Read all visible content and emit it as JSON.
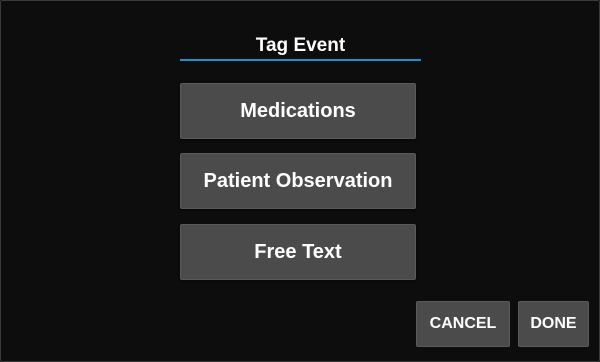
{
  "dialog": {
    "title": "Tag Event",
    "options": [
      {
        "label": "Medications"
      },
      {
        "label": "Patient Observation"
      },
      {
        "label": "Free Text"
      }
    ]
  },
  "actions": {
    "cancel_label": "CANCEL",
    "done_label": "DONE"
  },
  "colors": {
    "background": "#0d0d0d",
    "button": "#4b4b4b",
    "accent_underline": "#1e90d0",
    "text": "#ffffff"
  }
}
